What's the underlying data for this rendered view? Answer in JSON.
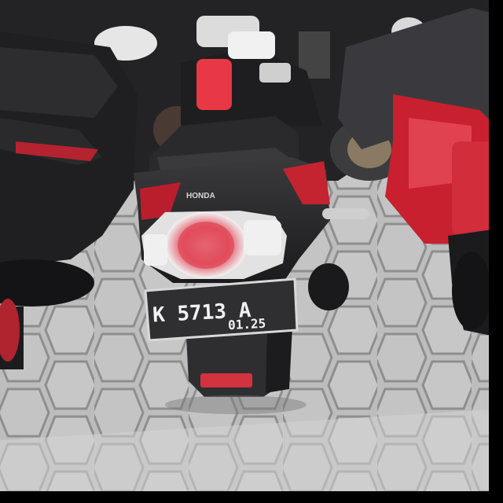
{
  "photo": {
    "subject": "motorcycle-rear-view",
    "brand_badge": "HONDA",
    "plate": {
      "line1": "K  5713  A",
      "line2": "01.25"
    },
    "colors": {
      "pavement": "#b9b9b9",
      "bike_body": "#262628",
      "accent_red": "#d8273a",
      "plate_bg": "#2e2e30",
      "black_border": "#000000"
    }
  }
}
